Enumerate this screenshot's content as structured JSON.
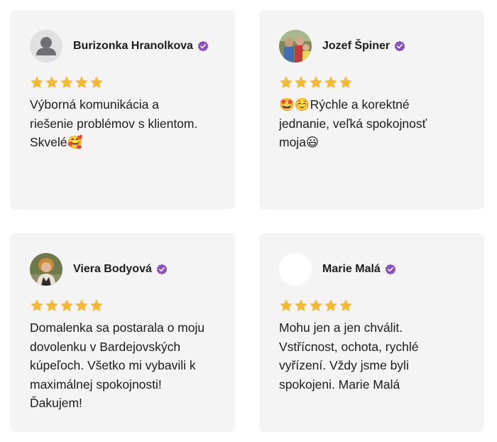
{
  "reviews": [
    {
      "name": "Burizonka Hranolkova",
      "avatar": "default-person-icon",
      "rating": 5,
      "lines": [
        "Výborná komunikácia a",
        "riešenie problémov s klientom.",
        "Skvelé🥰"
      ]
    },
    {
      "name": "Jozef Špiner",
      "avatar": "photo-family",
      "rating": 5,
      "lines": [
        "🤩☺️Rýchle a korektné",
        "jednanie, veľká spokojnosť",
        "moja😃"
      ]
    },
    {
      "name": "Viera Bodyová",
      "avatar": "photo-woman",
      "rating": 5,
      "lines": [
        "Domalenka sa postarala o moju",
        "dovolenku v Bardejovských",
        "kúpeľoch. Všetko mi vybavili k",
        "maximálnej spokojnosti!",
        "Ďakujem!"
      ]
    },
    {
      "name": "Marie Malá",
      "avatar": "blank",
      "rating": 5,
      "lines": [
        "Mohu jen a jen chválit.",
        "Vstřícnost, ochota, rychlé",
        "vyřízení. Vždy jsme byli",
        "spokojeni. Marie Malá"
      ]
    }
  ],
  "colors": {
    "star": "#f5b82e",
    "verified": "#8a4fc0",
    "card": "#f4f4f5"
  }
}
